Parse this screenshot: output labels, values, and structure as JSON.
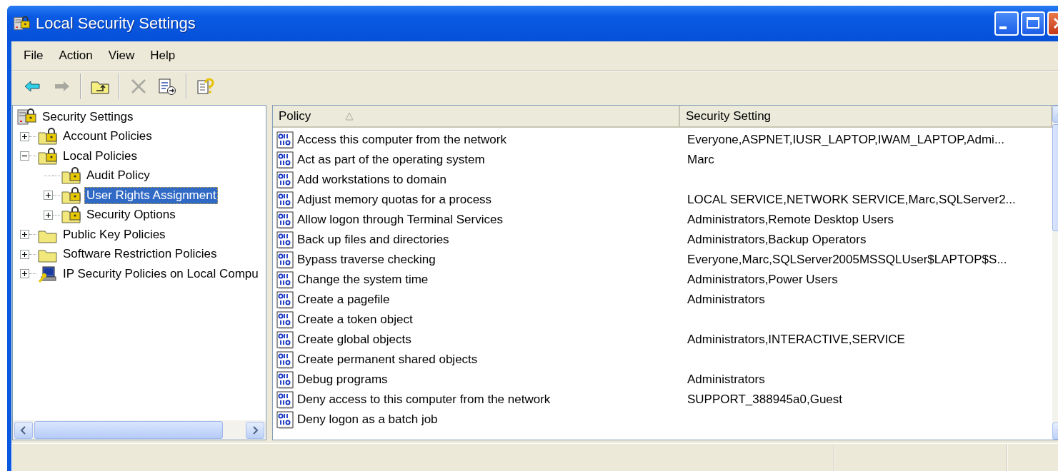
{
  "window": {
    "title": "Local Security Settings",
    "buttons": [
      {
        "kind": "minimize"
      },
      {
        "kind": "maximize"
      },
      {
        "kind": "close"
      }
    ]
  },
  "menu": [
    "File",
    "Action",
    "View",
    "Help"
  ],
  "toolbar": [
    [
      {
        "kind": "back",
        "disabled": false
      },
      {
        "kind": "forward",
        "disabled": true
      }
    ],
    [
      {
        "kind": "up",
        "disabled": false
      }
    ],
    [
      {
        "kind": "delete",
        "disabled": true
      },
      {
        "kind": "export",
        "disabled": false
      }
    ],
    [
      {
        "kind": "help",
        "disabled": false
      }
    ]
  ],
  "tree": {
    "label": "Security Settings",
    "kind": "root",
    "selected": false,
    "children": [
      {
        "label": "Account Policies",
        "kind": "locked-folder",
        "expander": true,
        "expanded": false,
        "selected": false
      },
      {
        "label": "Local Policies",
        "kind": "locked-folder",
        "expander": true,
        "expanded": true,
        "selected": false,
        "children": [
          {
            "label": "Audit Policy",
            "kind": "locked-folder",
            "expander": false,
            "expanded": false,
            "selected": false
          },
          {
            "label": "User Rights Assignment",
            "kind": "locked-folder",
            "expander": true,
            "expanded": false,
            "selected": true
          },
          {
            "label": "Security Options",
            "kind": "locked-folder",
            "expander": true,
            "expanded": false,
            "selected": false
          }
        ]
      },
      {
        "label": "Public Key Policies",
        "kind": "folder",
        "expander": true,
        "expanded": false,
        "selected": false
      },
      {
        "label": "Software Restriction Policies",
        "kind": "folder",
        "expander": true,
        "expanded": false,
        "selected": false
      },
      {
        "label": "IP Security Policies on Local Compu",
        "kind": "network",
        "expander": true,
        "expanded": false,
        "selected": false
      }
    ]
  },
  "list": {
    "columns": [
      {
        "label": "Policy",
        "sorted": true
      },
      {
        "label": "Security Setting",
        "sorted": false
      }
    ],
    "rows": [
      {
        "policy": "Access this computer from the network",
        "setting": "Everyone,ASPNET,IUSR_LAPTOP,IWAM_LAPTOP,Admi..."
      },
      {
        "policy": "Act as part of the operating system",
        "setting": "Marc"
      },
      {
        "policy": "Add workstations to domain"
      },
      {
        "policy": "Adjust memory quotas for a process",
        "setting": "LOCAL SERVICE,NETWORK SERVICE,Marc,SQLServer2..."
      },
      {
        "policy": "Allow logon through Terminal Services",
        "setting": "Administrators,Remote Desktop Users"
      },
      {
        "policy": "Back up files and directories",
        "setting": "Administrators,Backup Operators"
      },
      {
        "policy": "Bypass traverse checking",
        "setting": "Everyone,Marc,SQLServer2005MSSQLUser$LAPTOP$S..."
      },
      {
        "policy": "Change the system time",
        "setting": "Administrators,Power Users"
      },
      {
        "policy": "Create a pagefile",
        "setting": "Administrators"
      },
      {
        "policy": "Create a token object"
      },
      {
        "policy": "Create global objects",
        "setting": "Administrators,INTERACTIVE,SERVICE"
      },
      {
        "policy": "Create permanent shared objects"
      },
      {
        "policy": "Debug programs",
        "setting": "Administrators"
      },
      {
        "policy": "Deny access to this computer from the network",
        "setting": "SUPPORT_388945a0,Guest"
      },
      {
        "policy": "Deny logon as a batch job"
      }
    ]
  }
}
